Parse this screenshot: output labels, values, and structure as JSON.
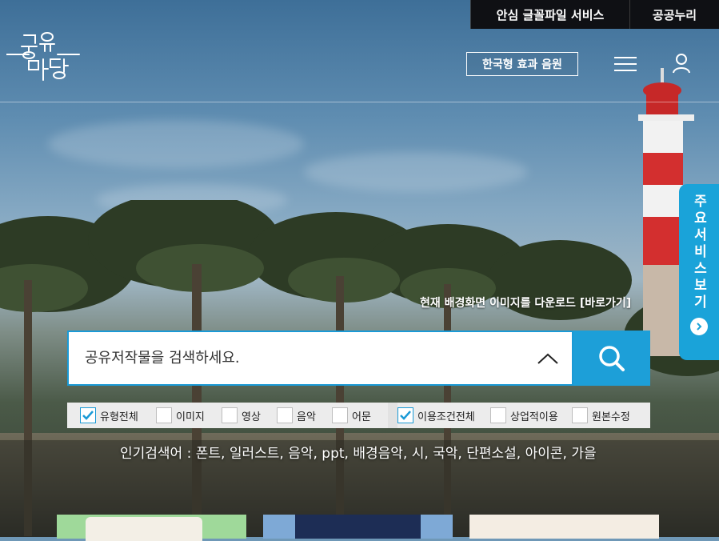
{
  "top_links": [
    "안심 글꼴파일 서비스",
    "공공누리"
  ],
  "logo": {
    "text": "공유마당"
  },
  "header": {
    "sound_button": "한국형 효과 음원"
  },
  "icons": {
    "menu": "hamburger-menu-icon",
    "user": "user-icon",
    "search": "search-icon",
    "chevron": "chevron-up-icon",
    "check": "check-icon",
    "arrow": "chevron-right-icon"
  },
  "side_tab": {
    "label": "주요서비스보기"
  },
  "background": {
    "download_label": "현재 배경화면 이미지를 다운로드 [바로가기]"
  },
  "search": {
    "placeholder": "공유저작물을 검색하세요."
  },
  "filters": {
    "type_group": [
      {
        "label": "유형전체",
        "checked": true
      },
      {
        "label": "이미지",
        "checked": false
      },
      {
        "label": "영상",
        "checked": false
      },
      {
        "label": "음악",
        "checked": false
      },
      {
        "label": "어문",
        "checked": false
      }
    ],
    "license_group": [
      {
        "label": "이용조건전체",
        "checked": true
      },
      {
        "label": "상업적이용",
        "checked": false
      },
      {
        "label": "원본수정",
        "checked": false
      }
    ]
  },
  "popular": {
    "text": "인기검색어 : 폰트, 일러스트, 음악, ppt, 배경음악, 시, 국악, 단편소설, 아이콘, 가을"
  },
  "colors": {
    "accent": "#1d9fd8",
    "topbar": "#0f1014",
    "filter_bg": "#ececec"
  }
}
